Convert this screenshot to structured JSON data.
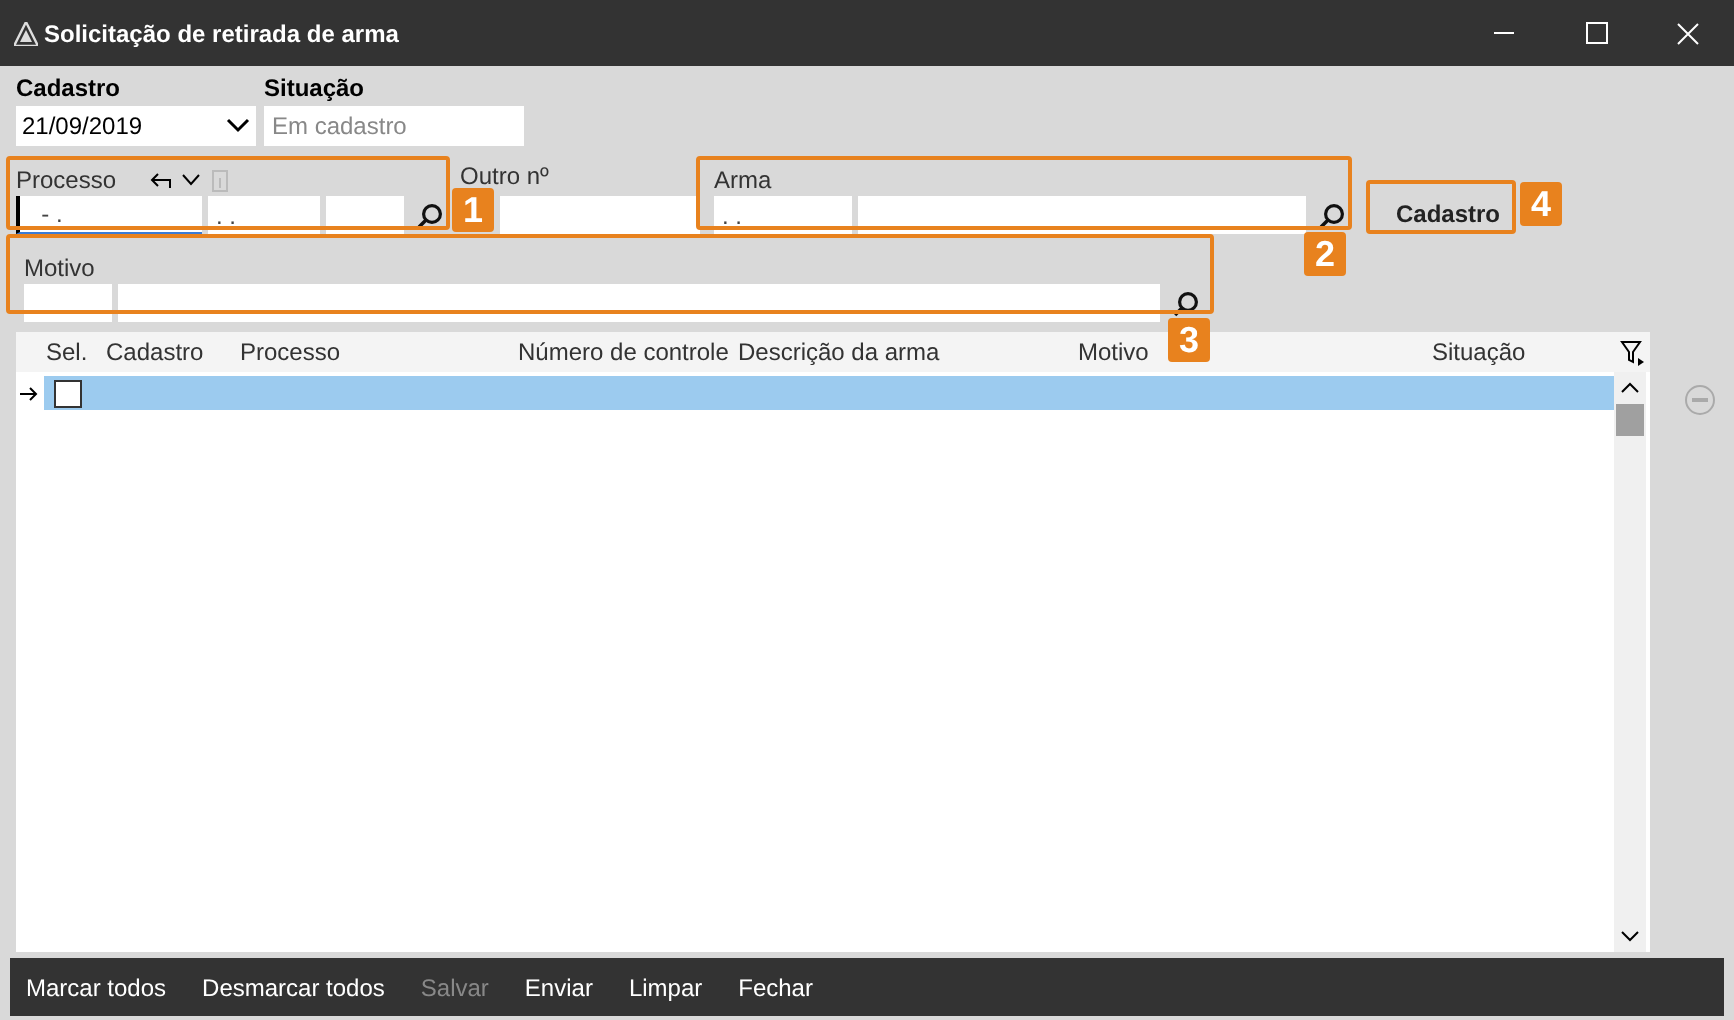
{
  "window": {
    "title": "Solicitação de retirada de arma"
  },
  "cadastro": {
    "label": "Cadastro",
    "value": "21/09/2019"
  },
  "situacao": {
    "label": "Situação",
    "placeholder": "Em cadastro"
  },
  "processo": {
    "label": "Processo",
    "values": [
      "  - .",
      ". ."
    ]
  },
  "outro": {
    "label": "Outro nº"
  },
  "arma": {
    "label": "Arma",
    "values": [
      ". ."
    ]
  },
  "cadastro_button": "Cadastro",
  "motivo": {
    "label": "Motivo"
  },
  "callouts": [
    "1",
    "2",
    "3",
    "4"
  ],
  "table": {
    "columns": [
      "Sel.",
      "Cadastro",
      "Processo",
      "Número de controle",
      "Descrição da arma",
      "Motivo",
      "Situação"
    ],
    "rows": [
      {
        "selected": true,
        "checked": false
      }
    ]
  },
  "footer": [
    {
      "label": "Marcar todos",
      "disabled": false
    },
    {
      "label": "Desmarcar todos",
      "disabled": false
    },
    {
      "label": "Salvar",
      "disabled": true
    },
    {
      "label": "Enviar",
      "disabled": false
    },
    {
      "label": "Limpar",
      "disabled": false
    },
    {
      "label": "Fechar",
      "disabled": false
    }
  ]
}
